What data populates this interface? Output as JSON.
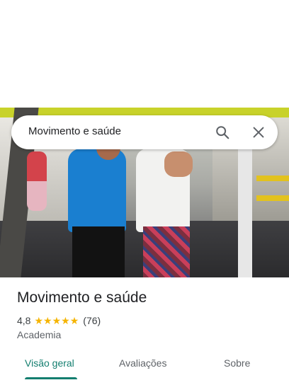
{
  "search": {
    "value": "Movimento e saúde",
    "search_icon": "search-icon",
    "close_icon": "close-icon"
  },
  "place": {
    "title": "Movimento e saúde",
    "rating": "4,8",
    "stars": 5,
    "review_count": "(76)",
    "category": "Academia"
  },
  "tabs": [
    {
      "label": "Visão geral",
      "active": true
    },
    {
      "label": "Avaliações",
      "active": false
    },
    {
      "label": "Sobre",
      "active": false
    }
  ],
  "colors": {
    "accent": "#137e6f",
    "star": "#f5b400"
  }
}
